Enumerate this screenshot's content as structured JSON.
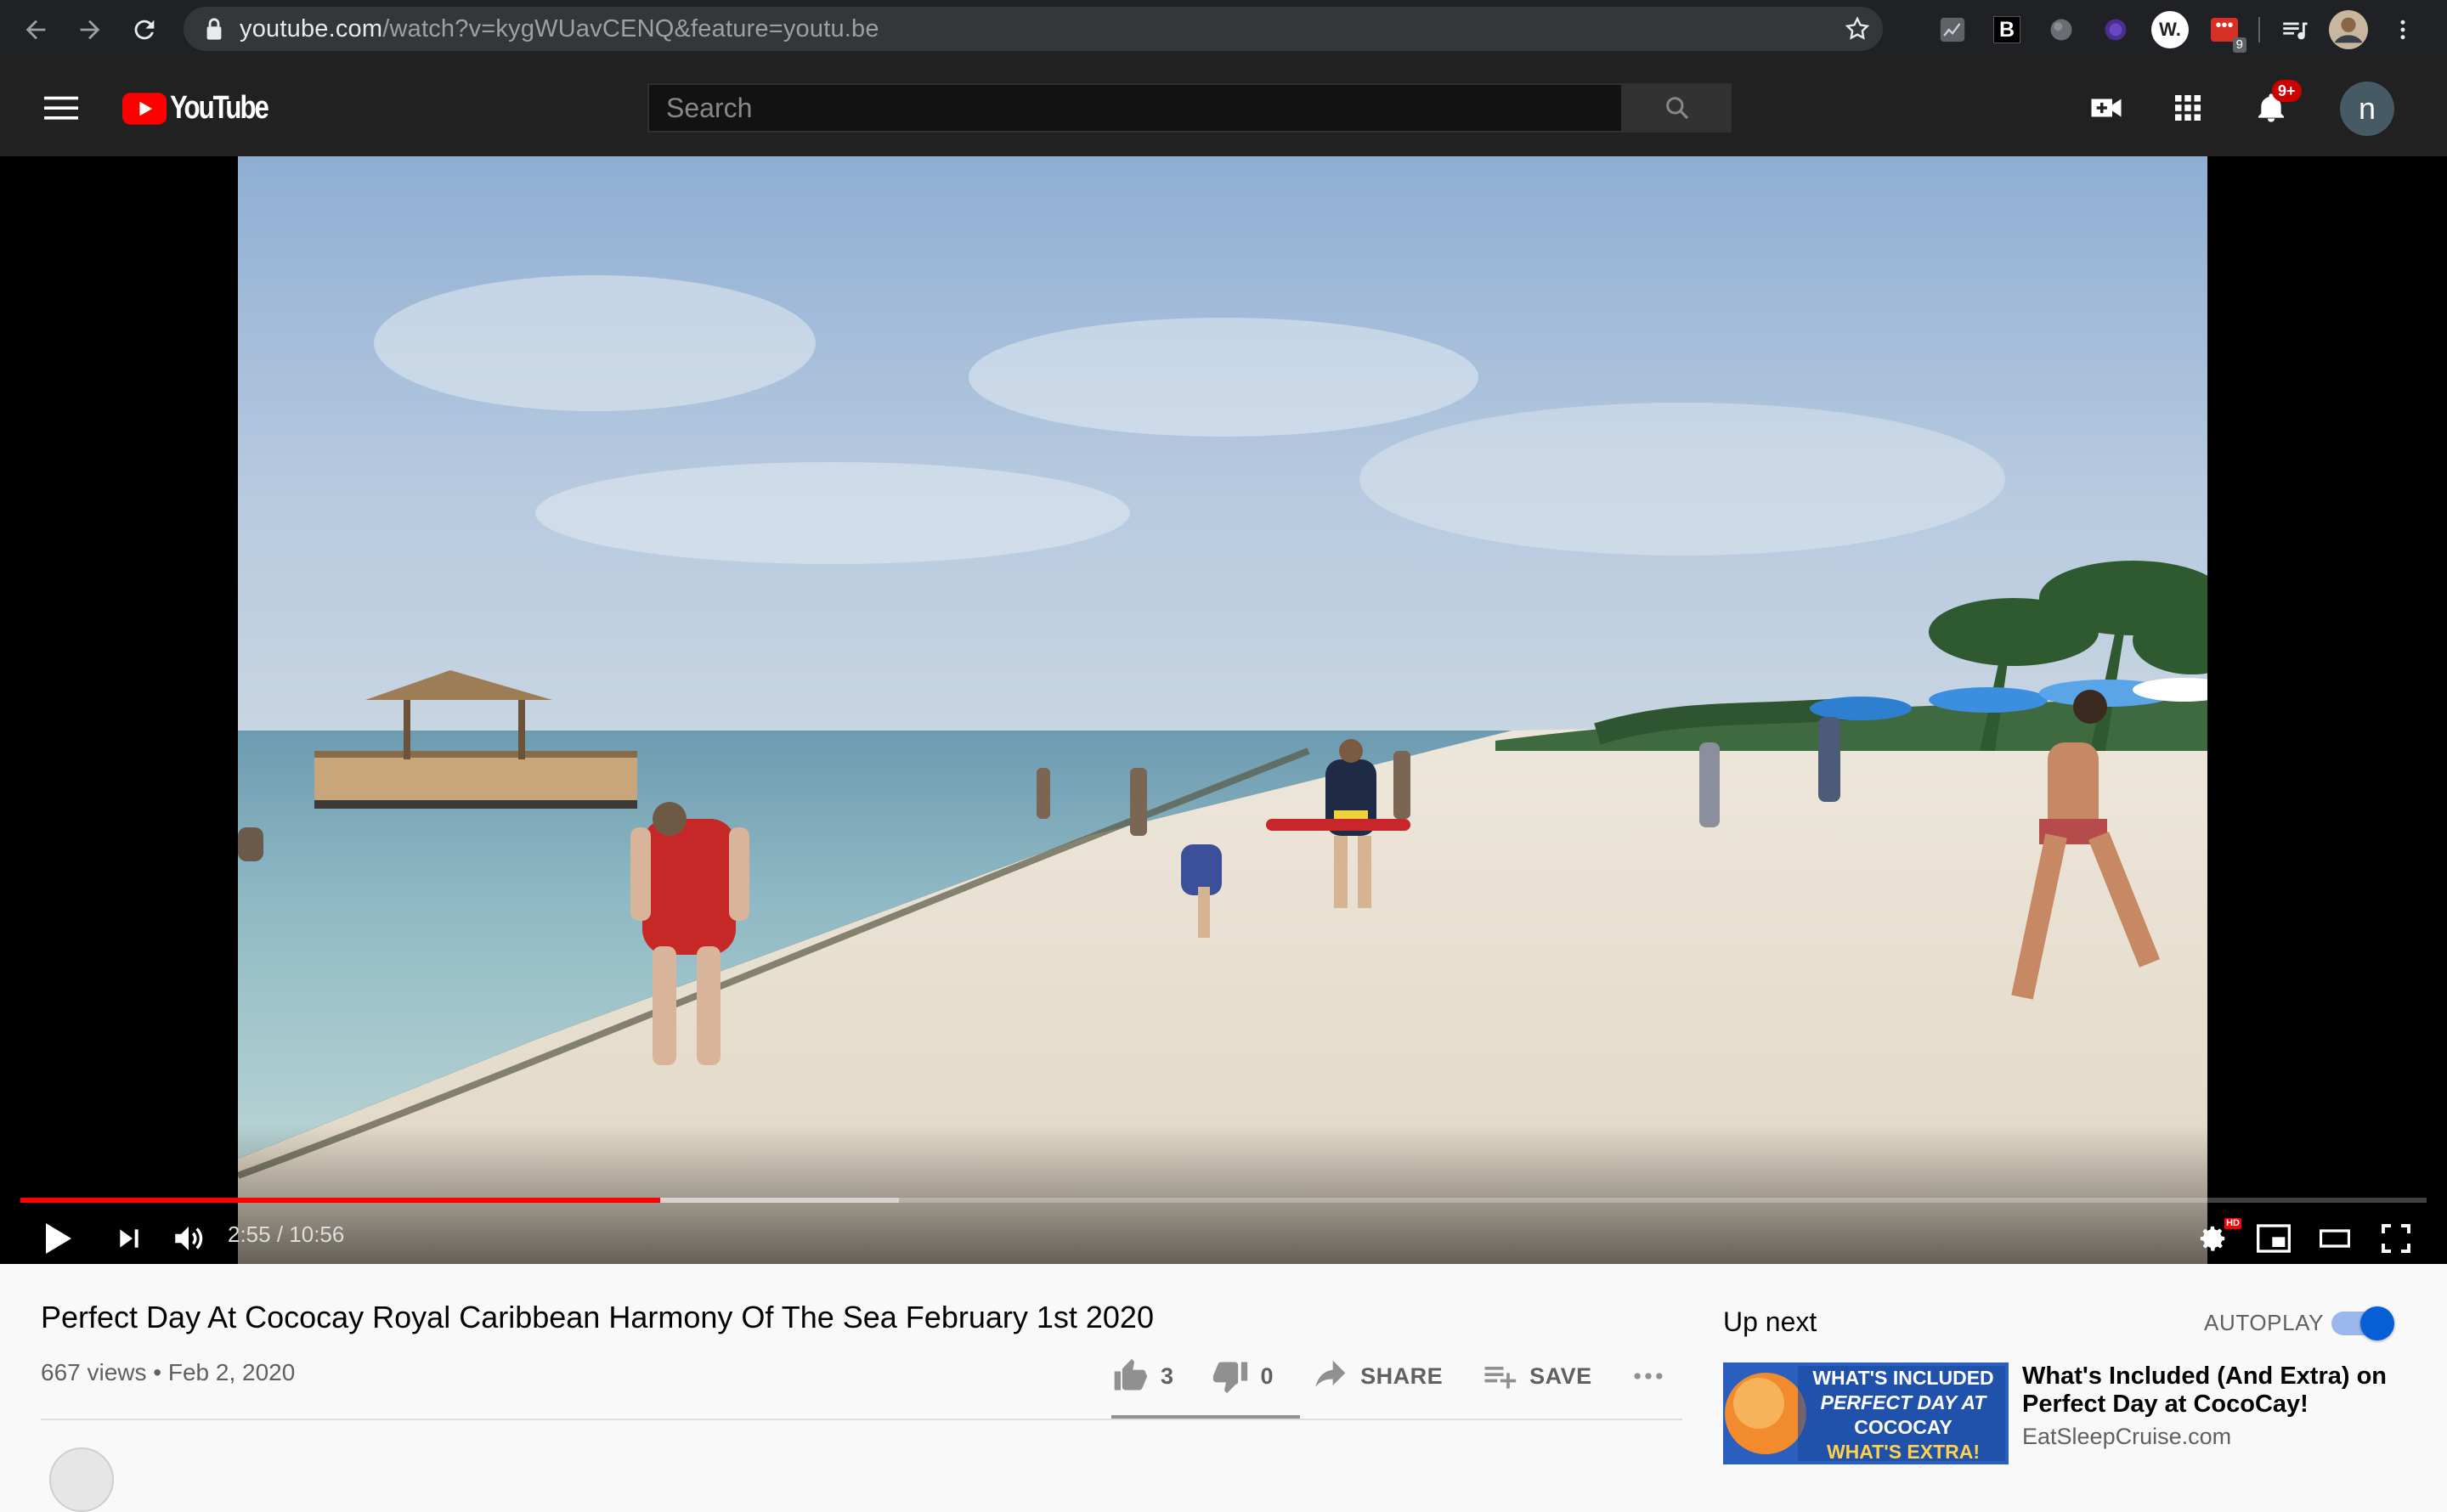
{
  "browser": {
    "url_host": "youtube.com",
    "url_path": "/watch?v=kygWUavCENQ&feature=youtu.be",
    "extension_badge": "9",
    "extension_w_label": "W.",
    "extension_b_label": "B"
  },
  "header": {
    "logo_text": "YouTube",
    "search_placeholder": "Search",
    "notification_count": "9+",
    "avatar_letter": "n"
  },
  "player": {
    "current_time": "2:55",
    "duration": "10:56",
    "time_display": "2:55 / 10:56",
    "played_fraction": 0.266,
    "buffered_fraction": 0.365,
    "hd_label": "HD"
  },
  "video": {
    "title": "Perfect Day At Cococay Royal Caribbean Harmony Of The Sea February 1st 2020",
    "meta": "667 views • Feb 2, 2020",
    "likes": "3",
    "dislikes": "0",
    "share_label": "SHARE",
    "save_label": "SAVE"
  },
  "up_next": {
    "label": "Up next",
    "autoplay_label": "AUTOPLAY",
    "autoplay_on": true,
    "items": [
      {
        "title": "What's Included (And Extra) on Perfect Day at CocoCay!",
        "channel": "EatSleepCruise.com",
        "thumb_text_1": "WHAT'S INCLUDED",
        "thumb_text_2": "PERFECT DAY AT",
        "thumb_text_3": "COCOCAY",
        "thumb_text_4": "WHAT'S EXTRA!"
      }
    ]
  },
  "colors": {
    "brand_red": "#ff0000",
    "header_bg": "#212121",
    "browser_bg": "#202124",
    "autoplay_blue": "#065fd4"
  }
}
